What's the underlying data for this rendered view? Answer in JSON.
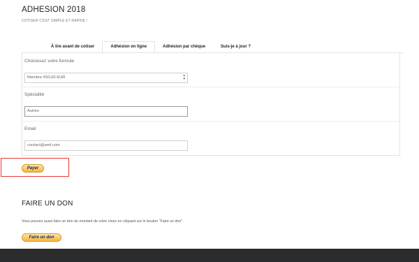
{
  "page": {
    "title": "ADHESION 2018",
    "subtitle": "COTISER C'EST SIMPLE ET RAPIDE !"
  },
  "tabs": [
    {
      "label": "À lire avant de cotiser",
      "active": false
    },
    {
      "label": "Adhésion en ligne",
      "active": true
    },
    {
      "label": "Adhésion par chèque",
      "active": false
    },
    {
      "label": "Suis-je à jour ?",
      "active": false
    }
  ],
  "form": {
    "formula": {
      "label": "Choisissez votre formule",
      "selected": "Membre €50,00 EUR"
    },
    "speciality": {
      "label": "Spécialité",
      "value": "Autres"
    },
    "email": {
      "label": "Email",
      "placeholder": "contact@amf.com"
    }
  },
  "pay_button": {
    "label": "Payer"
  },
  "don": {
    "title": "FAIRE UN DON",
    "text": "Vous pouvez aussi faire un don du montant de votre choix en cliquant sur le bouton \"Faire un don\".",
    "button_label": "Faire un don"
  }
}
